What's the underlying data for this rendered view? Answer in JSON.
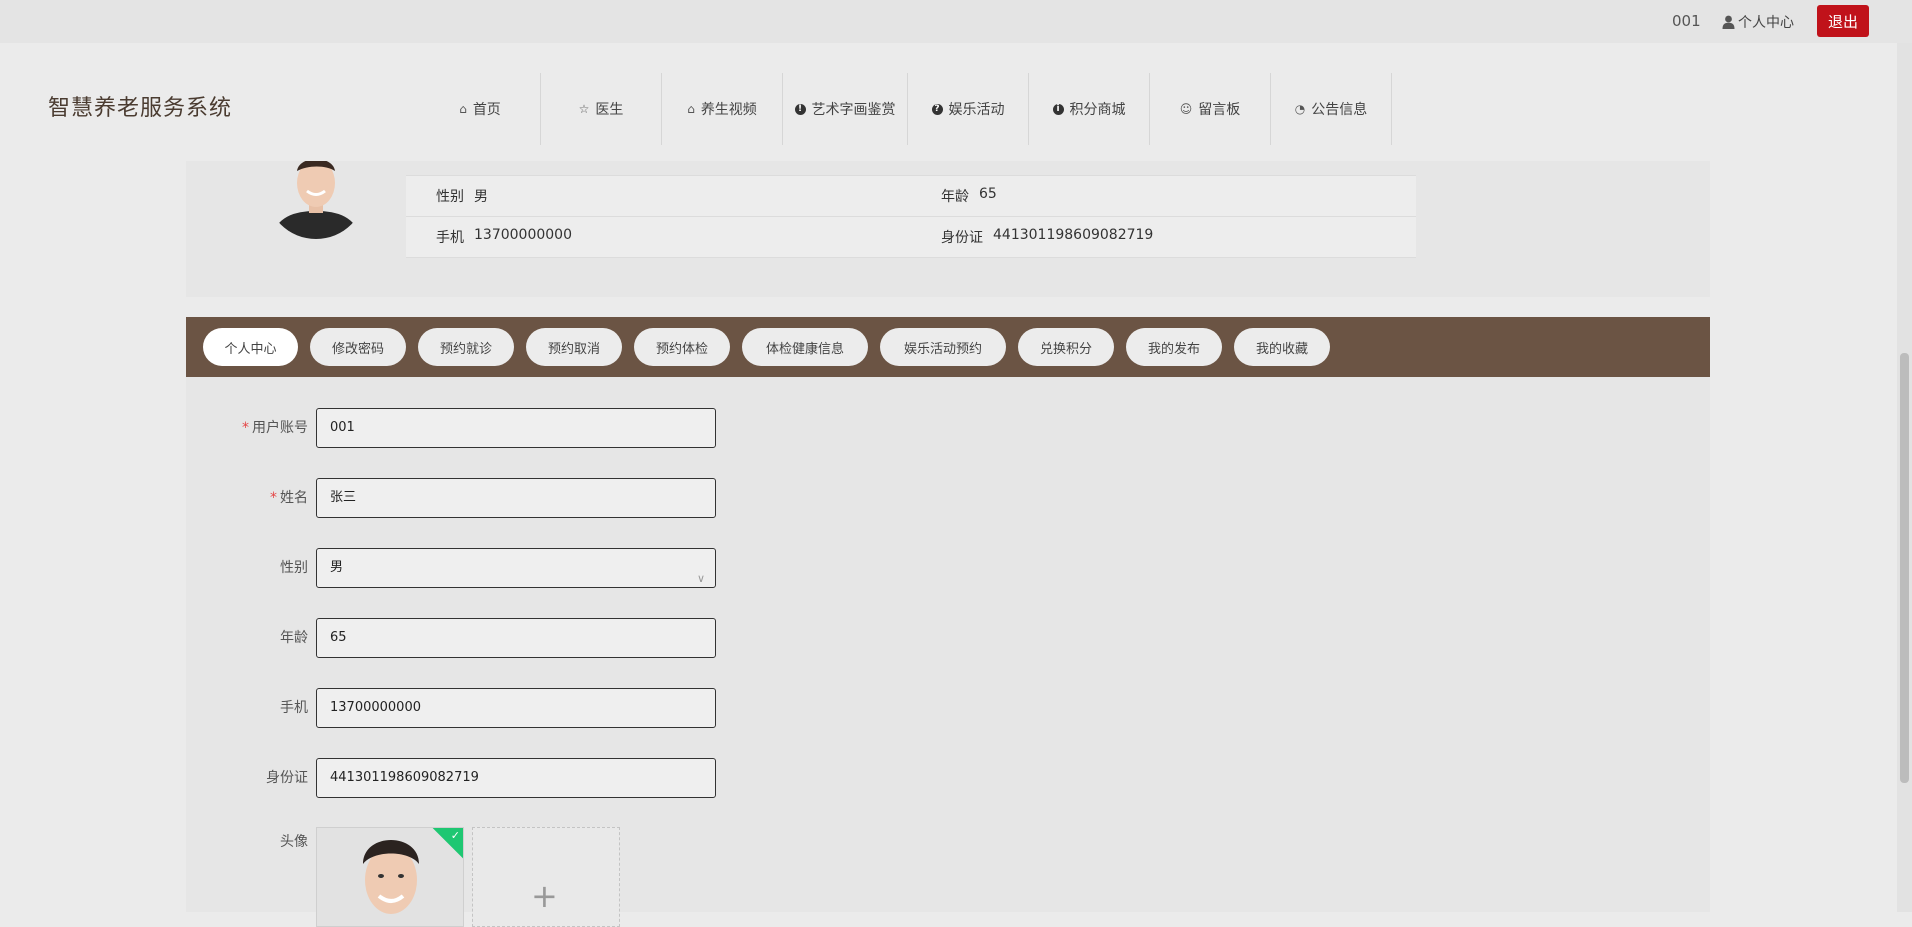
{
  "topbar": {
    "user_id": "001",
    "center_label": "个人中心",
    "logout_label": "退出"
  },
  "header": {
    "site_title": "智慧养老服务系统",
    "nav": [
      {
        "label": "首页",
        "icon": "home-icon"
      },
      {
        "label": "医生",
        "icon": "star-icon"
      },
      {
        "label": "养生视频",
        "icon": "bag-icon"
      },
      {
        "label": "艺术字画鉴赏",
        "icon": "alert-circle-icon"
      },
      {
        "label": "娱乐活动",
        "icon": "question-circle-icon"
      },
      {
        "label": "积分商城",
        "icon": "info-circle-icon"
      },
      {
        "label": "留言板",
        "icon": "smile-icon"
      },
      {
        "label": "公告信息",
        "icon": "check-circle-icon"
      }
    ]
  },
  "profile": {
    "gender_label": "性别",
    "gender_value": "男",
    "age_label": "年龄",
    "age_value": "65",
    "phone_label": "手机",
    "phone_value": "13700000000",
    "id_label": "身份证",
    "id_value": "441301198609082719"
  },
  "tabs": [
    "个人中心",
    "修改密码",
    "预约就诊",
    "预约取消",
    "预约体检",
    "体检健康信息",
    "娱乐活动预约",
    "兑换积分",
    "我的发布",
    "我的收藏"
  ],
  "form": {
    "account_label": "用户账号",
    "account_value": "001",
    "name_label": "姓名",
    "name_value": "张三",
    "gender_label": "性别",
    "gender_value": "男",
    "age_label": "年龄",
    "age_value": "65",
    "phone_label": "手机",
    "phone_value": "13700000000",
    "id_label": "身份证",
    "id_value": "441301198609082719",
    "avatar_label": "头像",
    "required_mark": "*"
  },
  "colors": {
    "tabbar": "#6b5444",
    "logout": "#c0121a",
    "success": "#1ec772"
  }
}
